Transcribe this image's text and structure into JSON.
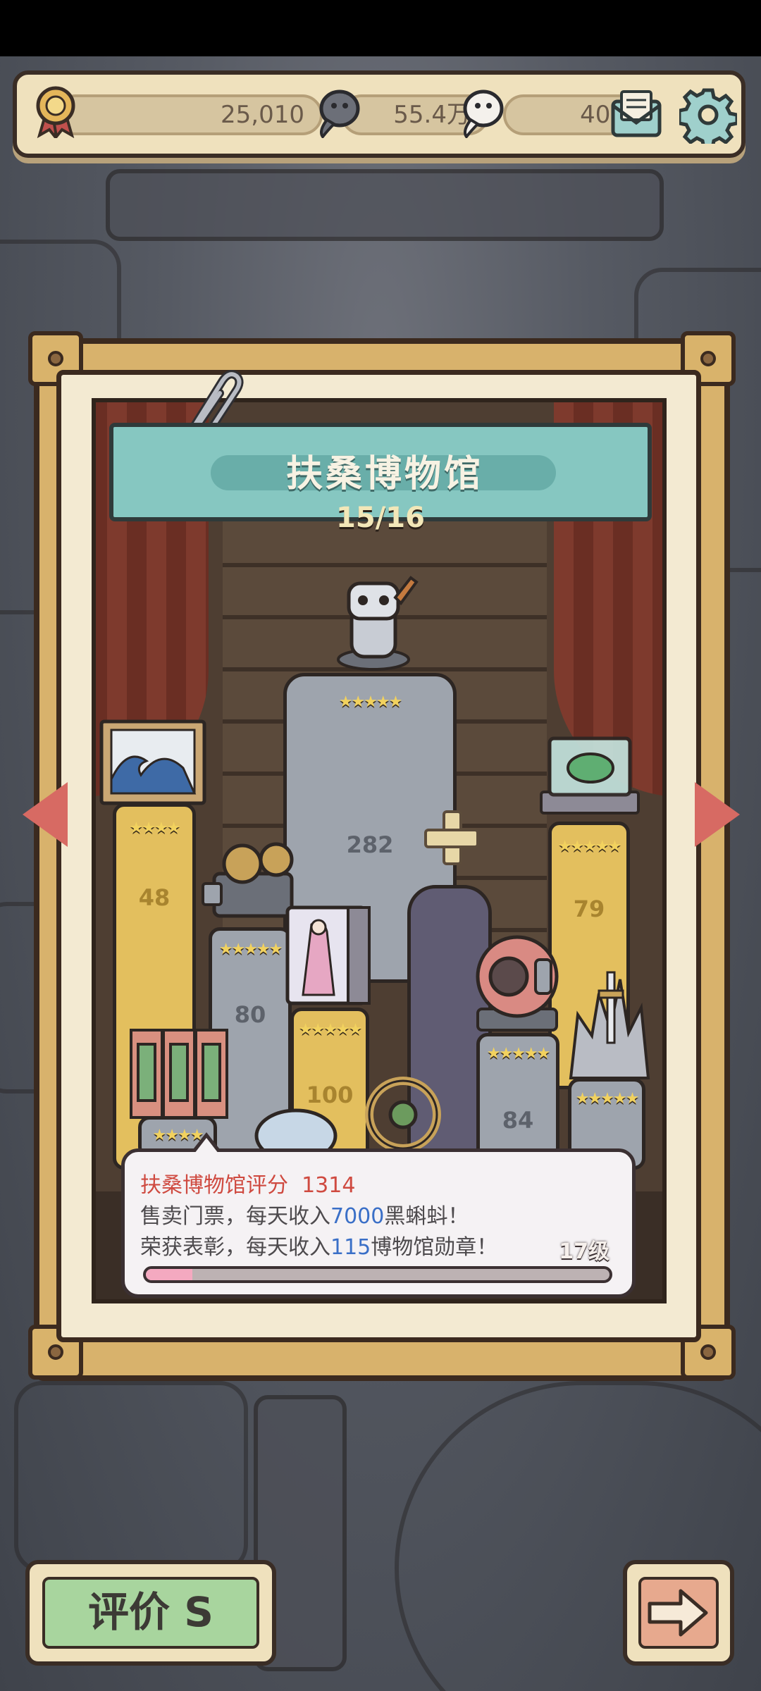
{
  "top_bar": {
    "medals_value": "25,010",
    "tadpole_black_value": "55.4万",
    "tadpole_white_value": "406",
    "icons": [
      "medal-icon",
      "black-tadpole-icon",
      "white-tadpole-icon",
      "mail-icon",
      "gear-icon"
    ]
  },
  "museum": {
    "title": "扶桑博物馆",
    "progress": "15/16",
    "pillars": [
      {
        "name": "wave-painting",
        "value": "48",
        "stars": "★★★★"
      },
      {
        "name": "film-projector",
        "value": "80",
        "stars": "★★★★★"
      },
      {
        "name": "center-statue",
        "value": "282",
        "stars": "★★★★★"
      },
      {
        "name": "lady-book",
        "value": "100",
        "stars": "★★★★★"
      },
      {
        "name": "glass-orb",
        "value": "79",
        "stars": "★★★★★"
      },
      {
        "name": "diving-helmet",
        "value": "84",
        "stars": "★★★★★"
      },
      {
        "name": "sword-throne",
        "value": "",
        "stars": "★★★★★"
      },
      {
        "name": "folding-screen",
        "value": "",
        "stars": "★★★★"
      }
    ]
  },
  "tooltip": {
    "rating_label": "扶桑博物馆评分",
    "rating_value": "1314",
    "line1_prefix": "售卖门票，每天收入",
    "line1_value": "7000",
    "line1_suffix": "黑蝌蚪！",
    "line2_prefix": "荣获表彰，每天收入",
    "line2_value": "115",
    "line2_suffix": "博物馆勋章！",
    "level": "17级",
    "level_progress": 0.1
  },
  "buttons": {
    "rate_label": "评价  S"
  },
  "colors": {
    "accent_red": "#cf4a40",
    "accent_blue": "#3a6fc7",
    "banner_teal": "#86c7c1",
    "button_green": "#a8d59e"
  }
}
